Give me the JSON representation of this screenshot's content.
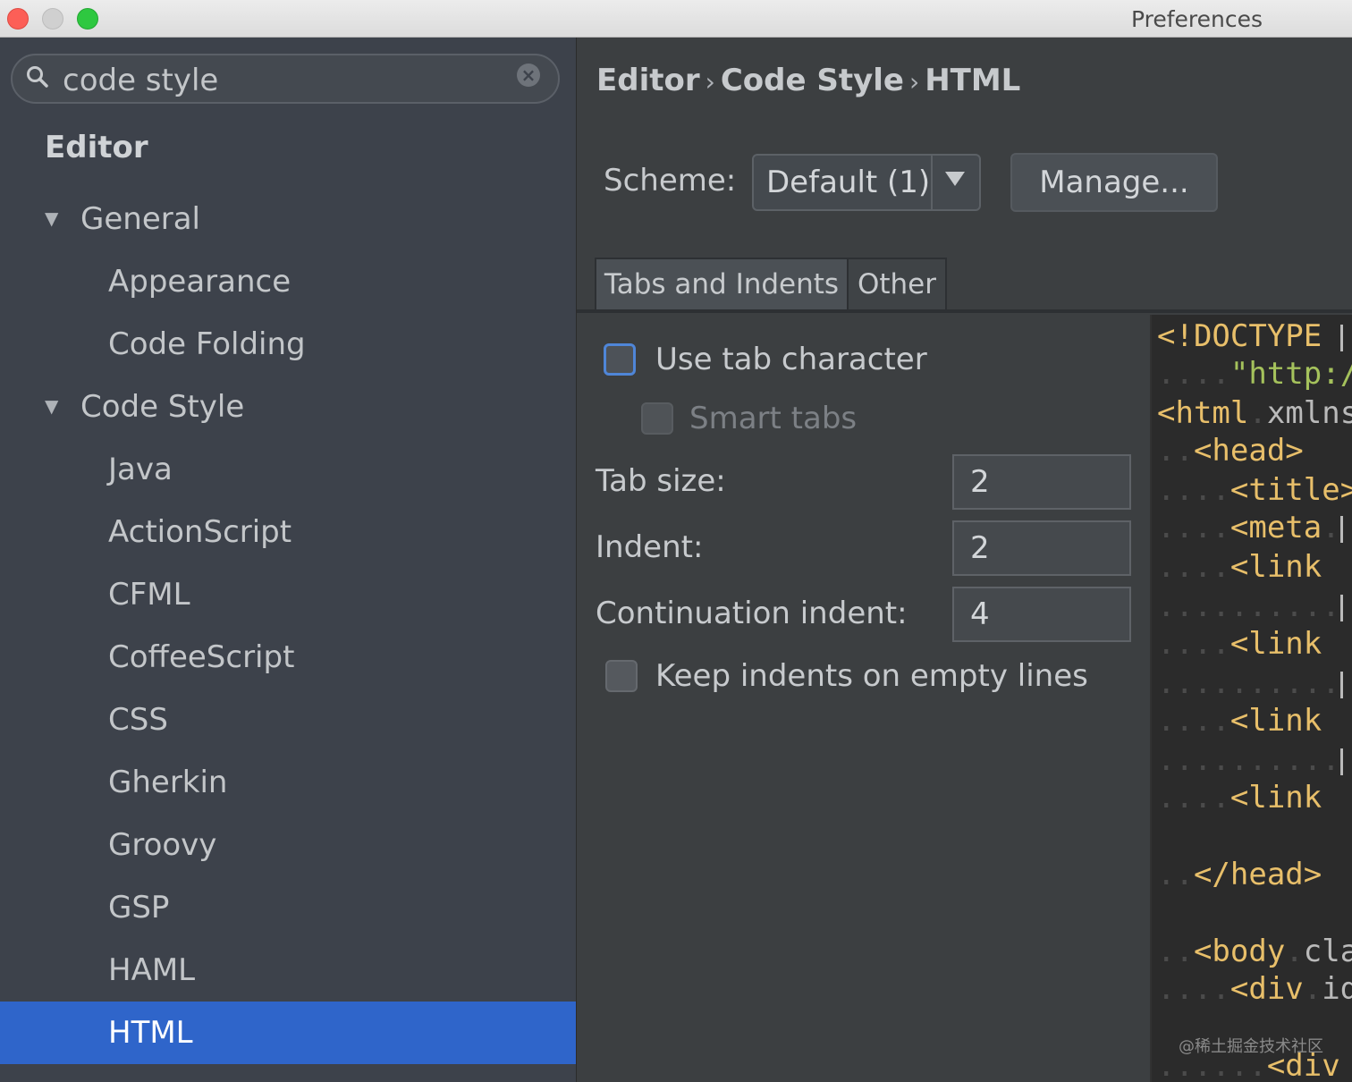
{
  "window": {
    "title": "Preferences"
  },
  "search": {
    "value": "code style"
  },
  "tree": {
    "section": "Editor",
    "items": [
      {
        "label": "General",
        "expanded": true
      },
      {
        "label": "Appearance"
      },
      {
        "label": "Code Folding"
      },
      {
        "label": "Code Style",
        "expanded": true
      },
      {
        "label": "Java"
      },
      {
        "label": "ActionScript"
      },
      {
        "label": "CFML"
      },
      {
        "label": "CoffeeScript"
      },
      {
        "label": "CSS"
      },
      {
        "label": "Gherkin"
      },
      {
        "label": "Groovy"
      },
      {
        "label": "GSP"
      },
      {
        "label": "HAML"
      },
      {
        "label": "HTML",
        "selected": true
      }
    ]
  },
  "breadcrumb": [
    "Editor",
    "Code Style",
    "HTML"
  ],
  "breadcrumb_separator": "›",
  "scheme": {
    "label": "Scheme:",
    "value": "Default (1)",
    "manage": "Manage..."
  },
  "tabs": [
    {
      "label": "Tabs and Indents",
      "active": true
    },
    {
      "label": "Other",
      "active": false
    }
  ],
  "options": {
    "use_tab_character": {
      "label": "Use tab character",
      "checked": false
    },
    "smart_tabs": {
      "label": "Smart tabs",
      "checked": false,
      "enabled": false
    },
    "tab_size": {
      "label": "Tab size:",
      "value": "2"
    },
    "indent": {
      "label": "Indent:",
      "value": "2"
    },
    "continuation_indent": {
      "label": "Continuation indent:",
      "value": "4"
    },
    "keep_indents": {
      "label": "Keep indents on empty lines",
      "checked": false
    }
  },
  "preview": {
    "lines": [
      {
        "dots": "",
        "tag": "<!DOCTYPE",
        "rest": ""
      },
      {
        "dots": "....",
        "str": "\"http:/"
      },
      {
        "dots": "",
        "tag": "<html",
        "attr": "xmlns"
      },
      {
        "dots": "..",
        "tag": "<head>"
      },
      {
        "dots": "....",
        "tag": "<title>"
      },
      {
        "dots": "....",
        "tag": "<meta"
      },
      {
        "dots": "....",
        "tag": "<link"
      },
      {
        "dots": "..........",
        "tag": ""
      },
      {
        "dots": "....",
        "tag": "<link"
      },
      {
        "dots": "..........",
        "tag": ""
      },
      {
        "dots": "....",
        "tag": "<link"
      },
      {
        "dots": "..........",
        "tag": ""
      },
      {
        "dots": "....",
        "tag": "<link"
      },
      {
        "dots": "",
        "tag": ""
      },
      {
        "dots": "..",
        "tag": "</head>"
      },
      {
        "dots": "",
        "tag": ""
      },
      {
        "dots": "..",
        "tag": "<body",
        "attr": "cla"
      },
      {
        "dots": "....",
        "tag": "<div",
        "attr": "id"
      },
      {
        "dots": "",
        "tag": ""
      },
      {
        "dots": "......",
        "tag": "<div"
      }
    ]
  },
  "watermark": "@稀土掘金技术社区",
  "colors": {
    "selection": "#2f65ca",
    "tag": "#e8bf6a",
    "string": "#a5c25c"
  }
}
